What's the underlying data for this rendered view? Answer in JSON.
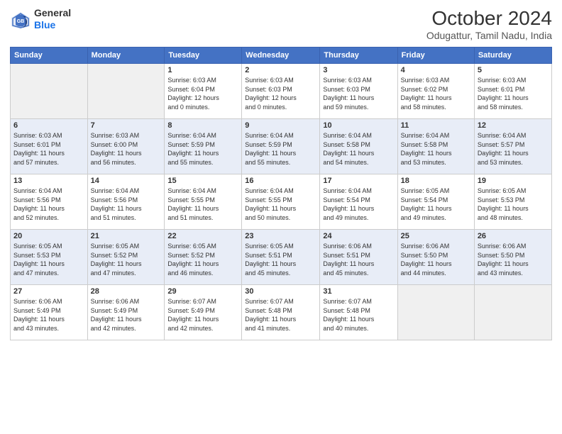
{
  "logo": {
    "line1": "General",
    "line2": "Blue"
  },
  "title": "October 2024",
  "subtitle": "Odugattur, Tamil Nadu, India",
  "days_of_week": [
    "Sunday",
    "Monday",
    "Tuesday",
    "Wednesday",
    "Thursday",
    "Friday",
    "Saturday"
  ],
  "weeks": [
    [
      {
        "day": "",
        "info": ""
      },
      {
        "day": "",
        "info": ""
      },
      {
        "day": "1",
        "info": "Sunrise: 6:03 AM\nSunset: 6:04 PM\nDaylight: 12 hours\nand 0 minutes."
      },
      {
        "day": "2",
        "info": "Sunrise: 6:03 AM\nSunset: 6:03 PM\nDaylight: 12 hours\nand 0 minutes."
      },
      {
        "day": "3",
        "info": "Sunrise: 6:03 AM\nSunset: 6:03 PM\nDaylight: 11 hours\nand 59 minutes."
      },
      {
        "day": "4",
        "info": "Sunrise: 6:03 AM\nSunset: 6:02 PM\nDaylight: 11 hours\nand 58 minutes."
      },
      {
        "day": "5",
        "info": "Sunrise: 6:03 AM\nSunset: 6:01 PM\nDaylight: 11 hours\nand 58 minutes."
      }
    ],
    [
      {
        "day": "6",
        "info": "Sunrise: 6:03 AM\nSunset: 6:01 PM\nDaylight: 11 hours\nand 57 minutes."
      },
      {
        "day": "7",
        "info": "Sunrise: 6:03 AM\nSunset: 6:00 PM\nDaylight: 11 hours\nand 56 minutes."
      },
      {
        "day": "8",
        "info": "Sunrise: 6:04 AM\nSunset: 5:59 PM\nDaylight: 11 hours\nand 55 minutes."
      },
      {
        "day": "9",
        "info": "Sunrise: 6:04 AM\nSunset: 5:59 PM\nDaylight: 11 hours\nand 55 minutes."
      },
      {
        "day": "10",
        "info": "Sunrise: 6:04 AM\nSunset: 5:58 PM\nDaylight: 11 hours\nand 54 minutes."
      },
      {
        "day": "11",
        "info": "Sunrise: 6:04 AM\nSunset: 5:58 PM\nDaylight: 11 hours\nand 53 minutes."
      },
      {
        "day": "12",
        "info": "Sunrise: 6:04 AM\nSunset: 5:57 PM\nDaylight: 11 hours\nand 53 minutes."
      }
    ],
    [
      {
        "day": "13",
        "info": "Sunrise: 6:04 AM\nSunset: 5:56 PM\nDaylight: 11 hours\nand 52 minutes."
      },
      {
        "day": "14",
        "info": "Sunrise: 6:04 AM\nSunset: 5:56 PM\nDaylight: 11 hours\nand 51 minutes."
      },
      {
        "day": "15",
        "info": "Sunrise: 6:04 AM\nSunset: 5:55 PM\nDaylight: 11 hours\nand 51 minutes."
      },
      {
        "day": "16",
        "info": "Sunrise: 6:04 AM\nSunset: 5:55 PM\nDaylight: 11 hours\nand 50 minutes."
      },
      {
        "day": "17",
        "info": "Sunrise: 6:04 AM\nSunset: 5:54 PM\nDaylight: 11 hours\nand 49 minutes."
      },
      {
        "day": "18",
        "info": "Sunrise: 6:05 AM\nSunset: 5:54 PM\nDaylight: 11 hours\nand 49 minutes."
      },
      {
        "day": "19",
        "info": "Sunrise: 6:05 AM\nSunset: 5:53 PM\nDaylight: 11 hours\nand 48 minutes."
      }
    ],
    [
      {
        "day": "20",
        "info": "Sunrise: 6:05 AM\nSunset: 5:53 PM\nDaylight: 11 hours\nand 47 minutes."
      },
      {
        "day": "21",
        "info": "Sunrise: 6:05 AM\nSunset: 5:52 PM\nDaylight: 11 hours\nand 47 minutes."
      },
      {
        "day": "22",
        "info": "Sunrise: 6:05 AM\nSunset: 5:52 PM\nDaylight: 11 hours\nand 46 minutes."
      },
      {
        "day": "23",
        "info": "Sunrise: 6:05 AM\nSunset: 5:51 PM\nDaylight: 11 hours\nand 45 minutes."
      },
      {
        "day": "24",
        "info": "Sunrise: 6:06 AM\nSunset: 5:51 PM\nDaylight: 11 hours\nand 45 minutes."
      },
      {
        "day": "25",
        "info": "Sunrise: 6:06 AM\nSunset: 5:50 PM\nDaylight: 11 hours\nand 44 minutes."
      },
      {
        "day": "26",
        "info": "Sunrise: 6:06 AM\nSunset: 5:50 PM\nDaylight: 11 hours\nand 43 minutes."
      }
    ],
    [
      {
        "day": "27",
        "info": "Sunrise: 6:06 AM\nSunset: 5:49 PM\nDaylight: 11 hours\nand 43 minutes."
      },
      {
        "day": "28",
        "info": "Sunrise: 6:06 AM\nSunset: 5:49 PM\nDaylight: 11 hours\nand 42 minutes."
      },
      {
        "day": "29",
        "info": "Sunrise: 6:07 AM\nSunset: 5:49 PM\nDaylight: 11 hours\nand 42 minutes."
      },
      {
        "day": "30",
        "info": "Sunrise: 6:07 AM\nSunset: 5:48 PM\nDaylight: 11 hours\nand 41 minutes."
      },
      {
        "day": "31",
        "info": "Sunrise: 6:07 AM\nSunset: 5:48 PM\nDaylight: 11 hours\nand 40 minutes."
      },
      {
        "day": "",
        "info": ""
      },
      {
        "day": "",
        "info": ""
      }
    ]
  ]
}
